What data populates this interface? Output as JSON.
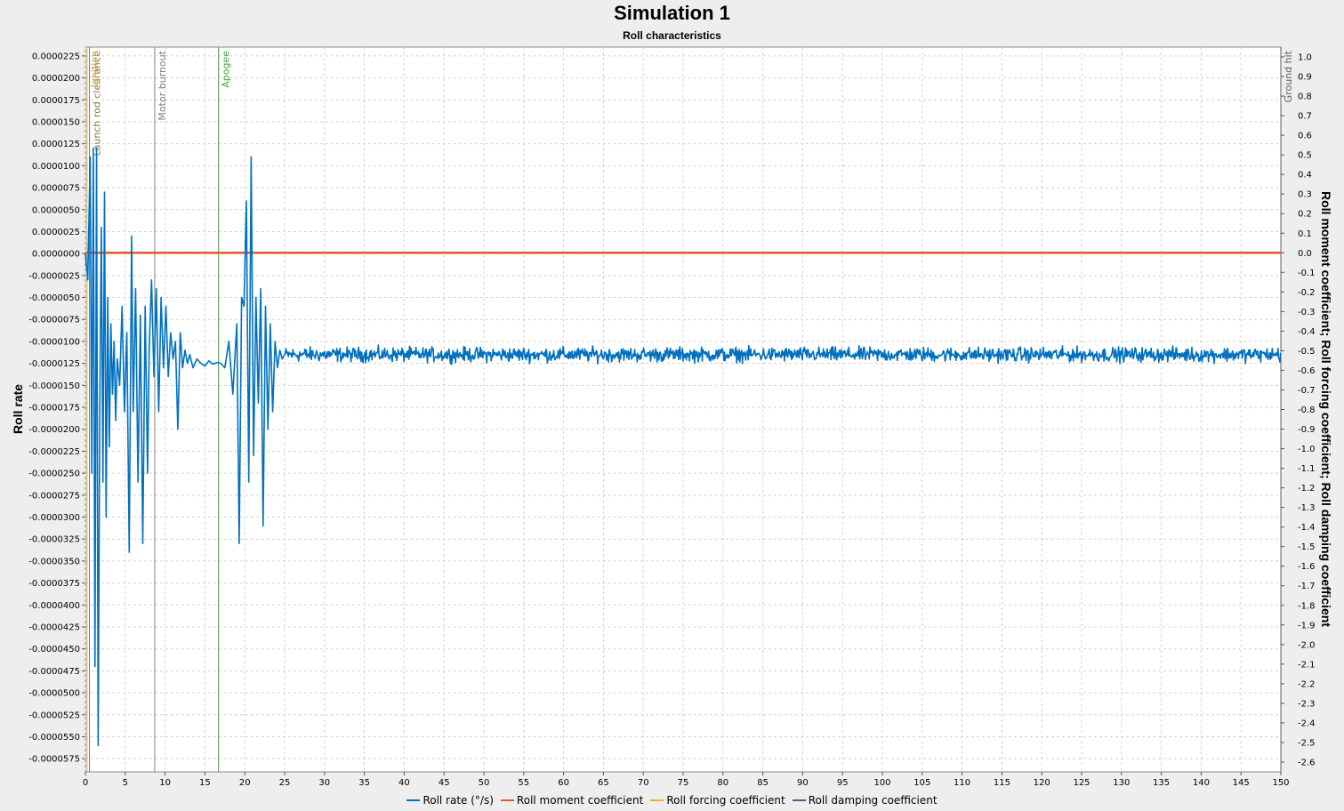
{
  "chart_data": {
    "type": "line",
    "title": "Simulation 1",
    "subtitle": "Roll characteristics",
    "xlabel": "",
    "ylabel_left": "Roll rate",
    "ylabel_right": "Roll moment coefficient; Roll forcing coefficient; Roll damping coefficient",
    "xlim": [
      0,
      150
    ],
    "ylim_left": [
      -5.9e-05,
      2.35e-05
    ],
    "ylim_right": [
      -2.65,
      1.05
    ],
    "x_ticks": [
      0,
      5,
      10,
      15,
      20,
      25,
      30,
      35,
      40,
      45,
      50,
      55,
      60,
      65,
      70,
      75,
      80,
      85,
      90,
      95,
      100,
      105,
      110,
      115,
      120,
      125,
      130,
      135,
      140,
      145,
      150
    ],
    "y_left_ticks": [
      "0.0000225",
      "0.0000200",
      "0.0000175",
      "0.0000150",
      "0.0000125",
      "0.0000100",
      "0.0000075",
      "0.0000050",
      "0.0000025",
      "0.0000000",
      "-0.0000025",
      "-0.0000050",
      "-0.0000075",
      "-0.0000100",
      "-0.0000125",
      "-0.0000150",
      "-0.0000175",
      "-0.0000200",
      "-0.0000225",
      "-0.0000250",
      "-0.0000275",
      "-0.0000300",
      "-0.0000325",
      "-0.0000350",
      "-0.0000375",
      "-0.0000400",
      "-0.0000425",
      "-0.0000450",
      "-0.0000475",
      "-0.0000500",
      "-0.0000525",
      "-0.0000550",
      "-0.0000575"
    ],
    "y_right_ticks": [
      "1.0",
      "0.9",
      "0.8",
      "0.7",
      "0.6",
      "0.5",
      "0.4",
      "0.3",
      "0.2",
      "0.1",
      "0.0",
      "-0.1",
      "-0.2",
      "-0.3",
      "-0.4",
      "-0.5",
      "-0.6",
      "-0.7",
      "-0.8",
      "-0.9",
      "-1.0",
      "-1.1",
      "-1.2",
      "-1.3",
      "-1.4",
      "-1.5",
      "-1.6",
      "-1.7",
      "-1.8",
      "-1.9",
      "-2.0",
      "-2.1",
      "-2.2",
      "-2.3",
      "-2.4",
      "-2.5",
      "-2.6"
    ],
    "grid": true,
    "legend_position": "bottom",
    "events": [
      {
        "label": "Launch rod clearance",
        "x": 0.5,
        "color": "#8a7a3a"
      },
      {
        "label": "Ignition",
        "x": 0.2,
        "color": "#c8a040"
      },
      {
        "label": "Motor burnout",
        "x": 8.7,
        "color": "#808080"
      },
      {
        "label": "Apogee",
        "x": 16.7,
        "color": "#40a040"
      },
      {
        "label": "Ground hit",
        "x": 150,
        "color": "#606060"
      }
    ],
    "series": [
      {
        "name": "Roll rate (°/s)",
        "axis": "left",
        "color": "#0070c0",
        "x": [
          0.0,
          0.3,
          0.6,
          0.8,
          1.0,
          1.2,
          1.4,
          1.6,
          1.8,
          2.0,
          2.2,
          2.4,
          2.6,
          2.8,
          3.0,
          3.2,
          3.4,
          3.6,
          3.8,
          4.0,
          4.3,
          4.6,
          4.9,
          5.2,
          5.5,
          5.8,
          6.0,
          6.3,
          6.6,
          6.9,
          7.2,
          7.5,
          7.8,
          8.0,
          8.3,
          8.6,
          8.9,
          9.2,
          9.5,
          9.8,
          10.1,
          10.4,
          10.7,
          11.0,
          11.3,
          11.6,
          11.9,
          12.2,
          12.5,
          12.8,
          13.1,
          13.5,
          14.0,
          14.5,
          15.0,
          15.5,
          16.0,
          16.5,
          17.0,
          17.5,
          18.0,
          18.5,
          19.0,
          19.3,
          19.6,
          19.9,
          20.2,
          20.5,
          20.8,
          21.1,
          21.4,
          21.7,
          22.0,
          22.3,
          22.6,
          22.9,
          23.2,
          23.5,
          23.8,
          24.1,
          24.4,
          24.7,
          25.0
        ],
        "values": [
          0.0,
          -3e-06,
          1.1e-05,
          -2.5e-05,
          1.2e-05,
          -4.7e-05,
          1.2e-05,
          -5.6e-05,
          -1.8e-05,
          3e-06,
          -2.6e-05,
          7e-06,
          -3e-05,
          -5e-06,
          -2.2e-05,
          -8e-06,
          -1.6e-05,
          -1e-05,
          -1.9e-05,
          -1.2e-05,
          -1.5e-05,
          -6e-06,
          -1.8e-05,
          -9e-06,
          -3.4e-05,
          2e-06,
          -1.8e-05,
          -4e-06,
          -2.6e-05,
          -7e-06,
          -3.3e-05,
          -6e-06,
          -2.5e-05,
          -1.1e-05,
          -3e-06,
          -1.4e-05,
          -4e-06,
          -1.8e-05,
          -5e-06,
          -1.3e-05,
          -6e-06,
          -1.4e-05,
          -9e-06,
          -1.2e-05,
          -1e-05,
          -2e-05,
          -9e-06,
          -1.3e-05,
          -1.1e-05,
          -1.25e-05,
          -1.15e-05,
          -1.3e-05,
          -1.2e-05,
          -1.25e-05,
          -1.28e-05,
          -1.22e-05,
          -1.26e-05,
          -1.24e-05,
          -1.25e-05,
          -1.3e-05,
          -1e-05,
          -1.6e-05,
          -8e-06,
          -3.3e-05,
          -5e-06,
          -6e-06,
          6e-06,
          -2.6e-05,
          1.1e-05,
          -2.3e-05,
          -5e-06,
          -1.7e-05,
          -4e-06,
          -3.1e-05,
          -6e-06,
          -2e-05,
          -8e-06,
          -1.8e-05,
          -1e-05,
          -1.3e-05,
          -1.1e-05,
          -1.2e-05,
          -1.15e-05
        ],
        "steady_state": {
          "x_start": 25,
          "x_end": 150,
          "mean": -1.15e-05,
          "noise_amplitude": 1.2e-06
        }
      },
      {
        "name": "Roll moment coefficient",
        "axis": "right",
        "color": "#e05a28",
        "x": [
          0,
          150
        ],
        "values": [
          0.0,
          0.0
        ]
      },
      {
        "name": "Roll forcing coefficient",
        "axis": "right",
        "color": "#f0b030",
        "x": [
          0,
          150
        ],
        "values": [
          0.0,
          0.0
        ]
      },
      {
        "name": "Roll damping coefficient",
        "axis": "right",
        "color": "#8040a0",
        "x": [
          0,
          150
        ],
        "values": [
          0.0,
          0.0
        ]
      }
    ]
  }
}
